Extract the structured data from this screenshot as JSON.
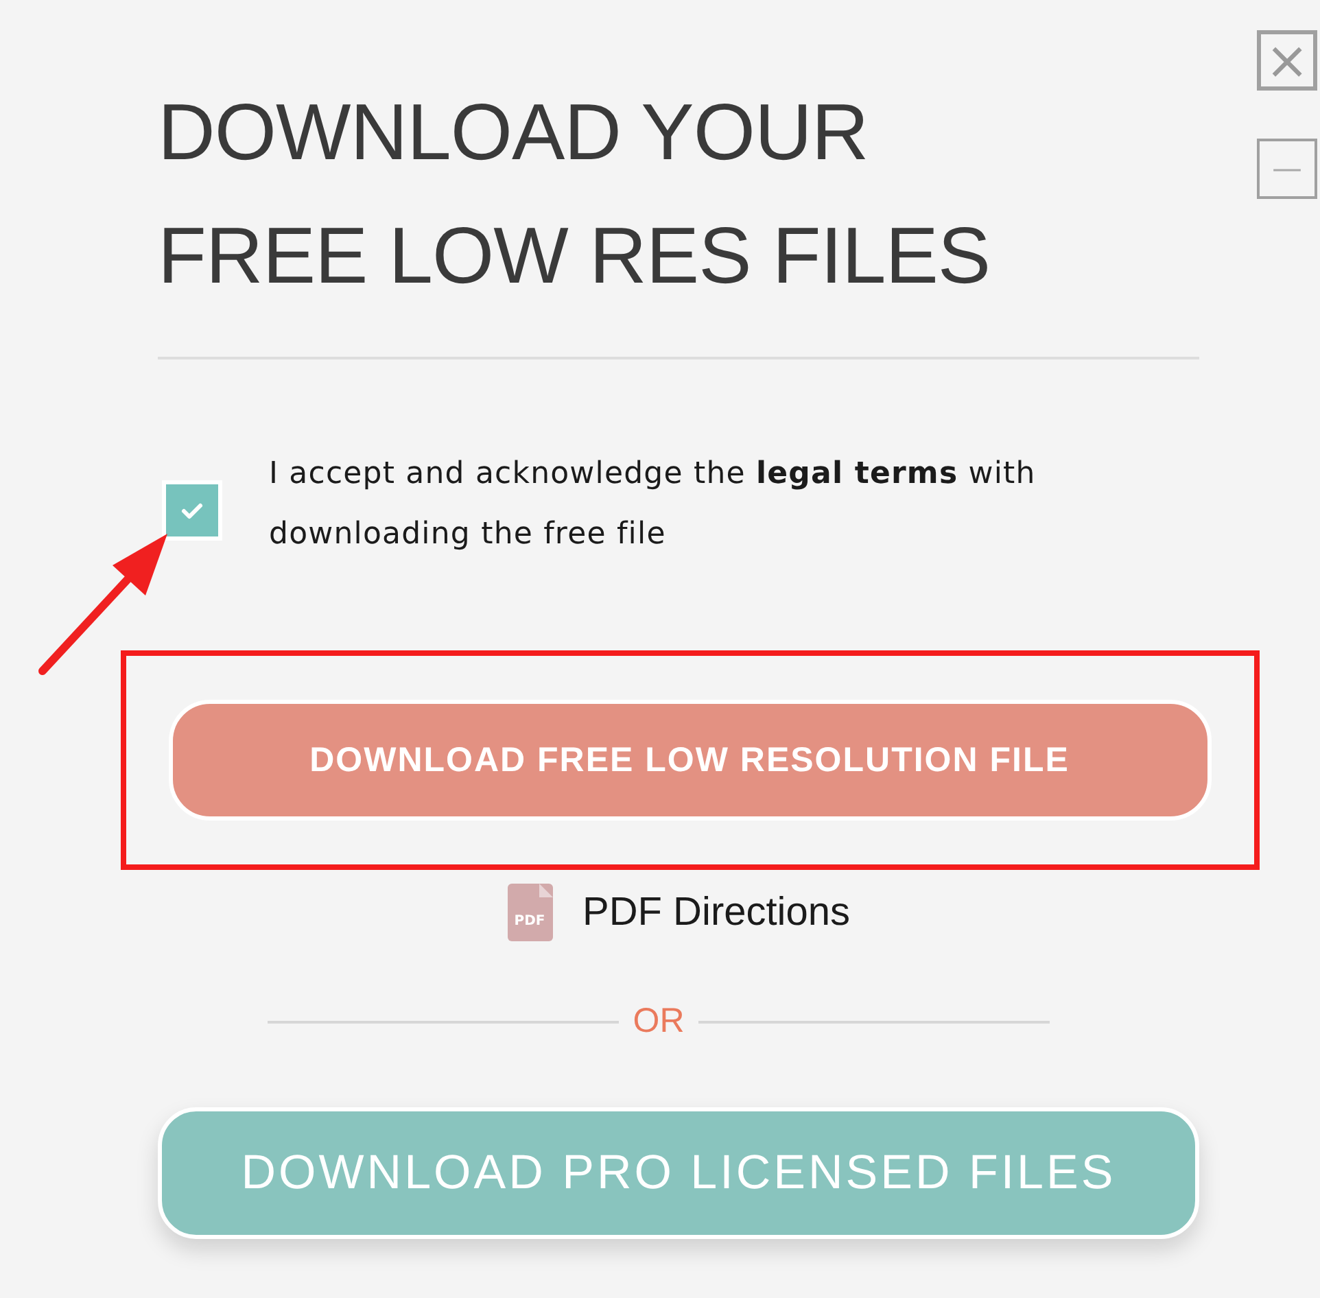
{
  "title": "DOWNLOAD YOUR FREE LOW RES FILES",
  "terms": {
    "checked": true,
    "text": "I accept and acknowledge the **legal terms** with downloading the free file"
  },
  "free_button": "DOWNLOAD FREE LOW RESOLUTION FILE",
  "pdf_link": {
    "icon_text": "PDF",
    "label": "PDF Directions"
  },
  "separator": "OR",
  "pro_button": "DOWNLOAD PRO LICENSED FILES",
  "window_controls": [
    {
      "kind": "close",
      "symbol": "×"
    },
    {
      "kind": "minimize",
      "symbol": "—"
    }
  ]
}
